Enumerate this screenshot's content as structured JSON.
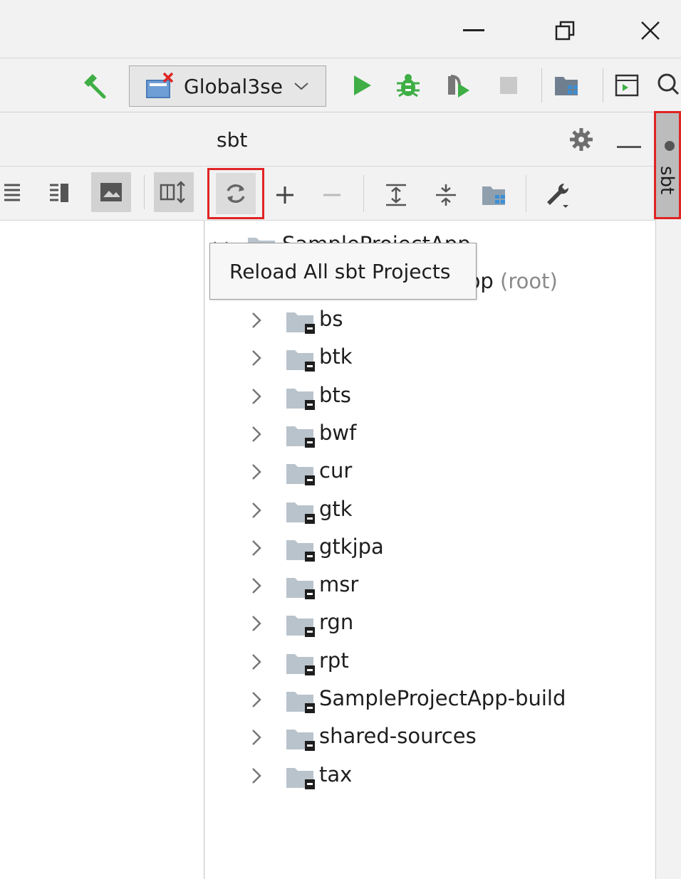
{
  "window": {
    "minimize_glyph": "—",
    "restore_glyph": "🗗",
    "close_glyph": "✕"
  },
  "toolbar": {
    "run_config_label": "Global3se",
    "icons": [
      "hammer-icon",
      "run-config-icon",
      "run-icon",
      "debug-icon",
      "coverage-icon",
      "stop-icon",
      "project-structure-icon",
      "terminal-icon",
      "search-icon"
    ]
  },
  "sbt_panel": {
    "title": "sbt",
    "tooltip": "Reload All sbt Projects",
    "root_hidden_text": "SampleProjectApp",
    "root_visible_text": "pp",
    "root_suffix": "(root)",
    "modules": [
      {
        "name": "bs"
      },
      {
        "name": "btk"
      },
      {
        "name": "bts"
      },
      {
        "name": "bwf"
      },
      {
        "name": "cur"
      },
      {
        "name": "gtk"
      },
      {
        "name": "gtkjpa"
      },
      {
        "name": "msr"
      },
      {
        "name": "rgn"
      },
      {
        "name": "rpt"
      },
      {
        "name": "SampleProjectApp-build"
      },
      {
        "name": "shared-sources"
      },
      {
        "name": "tax"
      }
    ]
  },
  "right_strip": {
    "tab_label": "sbt"
  },
  "colors": {
    "highlight_red": "#e02424",
    "run_green": "#3fae45",
    "folder_gray": "#b9c3cc"
  }
}
